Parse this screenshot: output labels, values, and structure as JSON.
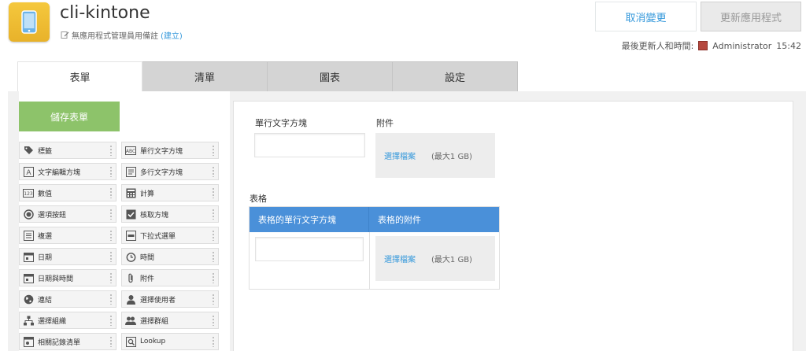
{
  "header": {
    "app_name": "cli-kintone",
    "memo_text": "無應用程式管理員用備註",
    "memo_link": "(建立)",
    "cancel_label": "取消變更",
    "update_label": "更新應用程式",
    "last_updated_label": "最後更新人和時間:",
    "last_updated_user": "Administrator",
    "last_updated_time": "15:42"
  },
  "tabs": [
    {
      "label": "表單"
    },
    {
      "label": "清單"
    },
    {
      "label": "圖表"
    },
    {
      "label": "設定"
    }
  ],
  "palette": {
    "save_label": "儲存表單",
    "items": [
      {
        "label": "標籤",
        "icon": "tag-icon"
      },
      {
        "label": "單行文字方塊",
        "icon": "abc-icon"
      },
      {
        "label": "文字編輯方塊",
        "icon": "rich-text-icon"
      },
      {
        "label": "多行文字方塊",
        "icon": "multiline-icon"
      },
      {
        "label": "數值",
        "icon": "number-icon"
      },
      {
        "label": "計算",
        "icon": "calculator-icon"
      },
      {
        "label": "選項按鈕",
        "icon": "radio-icon"
      },
      {
        "label": "核取方塊",
        "icon": "checkbox-icon"
      },
      {
        "label": "複選",
        "icon": "multi-select-icon"
      },
      {
        "label": "下拉式選單",
        "icon": "dropdown-icon"
      },
      {
        "label": "日期",
        "icon": "date-icon"
      },
      {
        "label": "時間",
        "icon": "clock-icon"
      },
      {
        "label": "日期與時間",
        "icon": "datetime-icon"
      },
      {
        "label": "附件",
        "icon": "paperclip-icon"
      },
      {
        "label": "連結",
        "icon": "globe-icon"
      },
      {
        "label": "選擇使用者",
        "icon": "user-icon"
      },
      {
        "label": "選擇組織",
        "icon": "org-icon"
      },
      {
        "label": "選擇群組",
        "icon": "group-icon"
      },
      {
        "label": "相關記錄清單",
        "icon": "related-records-icon"
      },
      {
        "label": "Lookup",
        "icon": "lookup-icon"
      }
    ]
  },
  "canvas": {
    "text_field_label": "單行文字方塊",
    "attachment_label": "附件",
    "choose_file": "選擇檔案",
    "size_limit": "(最大1 GB)",
    "table_label": "表格",
    "table_col1": "表格的單行文字方塊",
    "table_col2": "表格的附件"
  },
  "colors": {
    "accent": "#3498db",
    "save_green": "#8dc36a",
    "table_header": "#4a90d9",
    "app_icon": "#f5c83d"
  }
}
